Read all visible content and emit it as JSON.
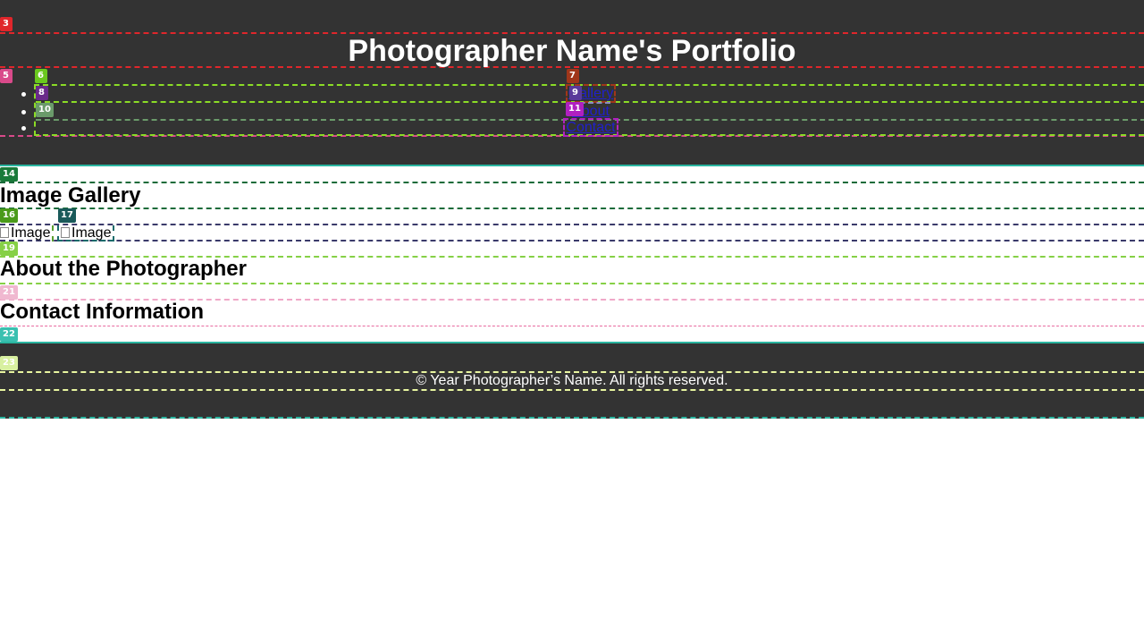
{
  "header": {
    "title": "Photographer Name's Portfolio"
  },
  "nav": {
    "items": [
      {
        "label": "Gallery"
      },
      {
        "label": "About"
      },
      {
        "label": "Contact"
      }
    ]
  },
  "gallery": {
    "heading": "Image Gallery",
    "images": [
      {
        "alt": "Image"
      },
      {
        "alt": "Image"
      }
    ]
  },
  "about": {
    "heading": "About the Photographer"
  },
  "contact": {
    "heading": "Contact Information"
  },
  "footer": {
    "copyright": "© Year Photographer’s Name. All rights reserved."
  },
  "overlay_badges": [
    "3",
    "5",
    "6",
    "7",
    "8",
    "9",
    "10",
    "11",
    "14",
    "16",
    "17",
    "19",
    "21",
    "22",
    "23"
  ],
  "colors": {
    "header_bg": "#333333",
    "link": "#2020cc",
    "text_light": "#ffffff"
  }
}
